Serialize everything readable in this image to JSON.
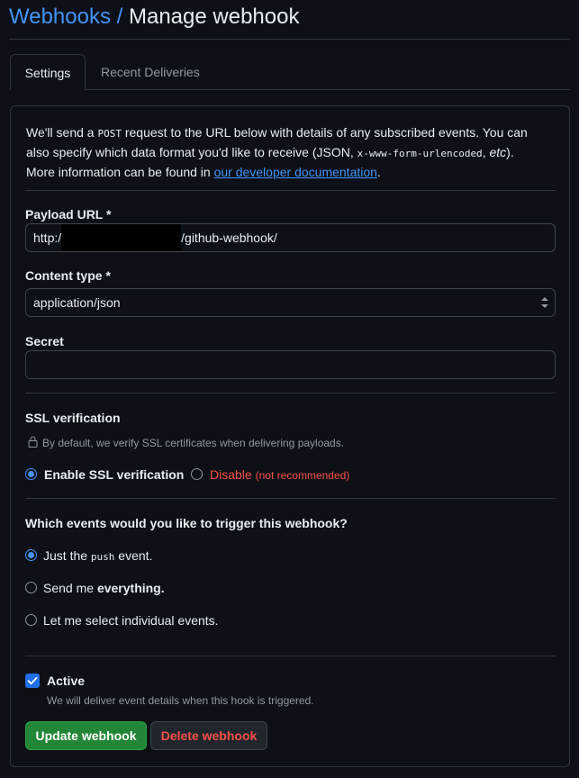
{
  "header": {
    "crumb": "Webhooks",
    "separator": " / ",
    "title": "Manage webhook"
  },
  "tabs": [
    {
      "label": "Settings",
      "active": true
    },
    {
      "label": "Recent Deliveries",
      "active": false
    }
  ],
  "intro": {
    "part1": "We'll send a ",
    "code1": "POST",
    "part2": " request to the URL below with details of any subscribed events. You can also specify which data format you'd like to receive (JSON, ",
    "code2": "x-www-form-urlencoded",
    "part3": ", ",
    "em": "etc",
    "part4": "). More information can be found in ",
    "link": "our developer documentation",
    "part5": "."
  },
  "payload_url": {
    "label": "Payload URL *",
    "value_prefix": "http:/",
    "value_suffix": "/github-webhook/"
  },
  "content_type": {
    "label": "Content type *",
    "value": "application/json"
  },
  "secret": {
    "label": "Secret",
    "value": ""
  },
  "ssl": {
    "heading": "SSL verification",
    "note": "By default, we verify SSL certificates when delivering payloads.",
    "enable_label": "Enable SSL verification",
    "disable_label": "Disable",
    "disable_note": "(not recommended)",
    "selected": "enable"
  },
  "events": {
    "heading": "Which events would you like to trigger this webhook?",
    "opt_push_prefix": "Just the ",
    "opt_push_code": "push",
    "opt_push_suffix": " event.",
    "opt_all_prefix": "Send me ",
    "opt_all_bold": "everything.",
    "opt_select": "Let me select individual events.",
    "selected": "push"
  },
  "active": {
    "label": "Active",
    "checked": true,
    "note": "We will deliver event details when this hook is triggered."
  },
  "buttons": {
    "update": "Update webhook",
    "delete": "Delete webhook"
  },
  "colors": {
    "accent": "#4493f8",
    "primary_button": "#238636",
    "danger": "#f85149",
    "background": "#0d1117"
  }
}
